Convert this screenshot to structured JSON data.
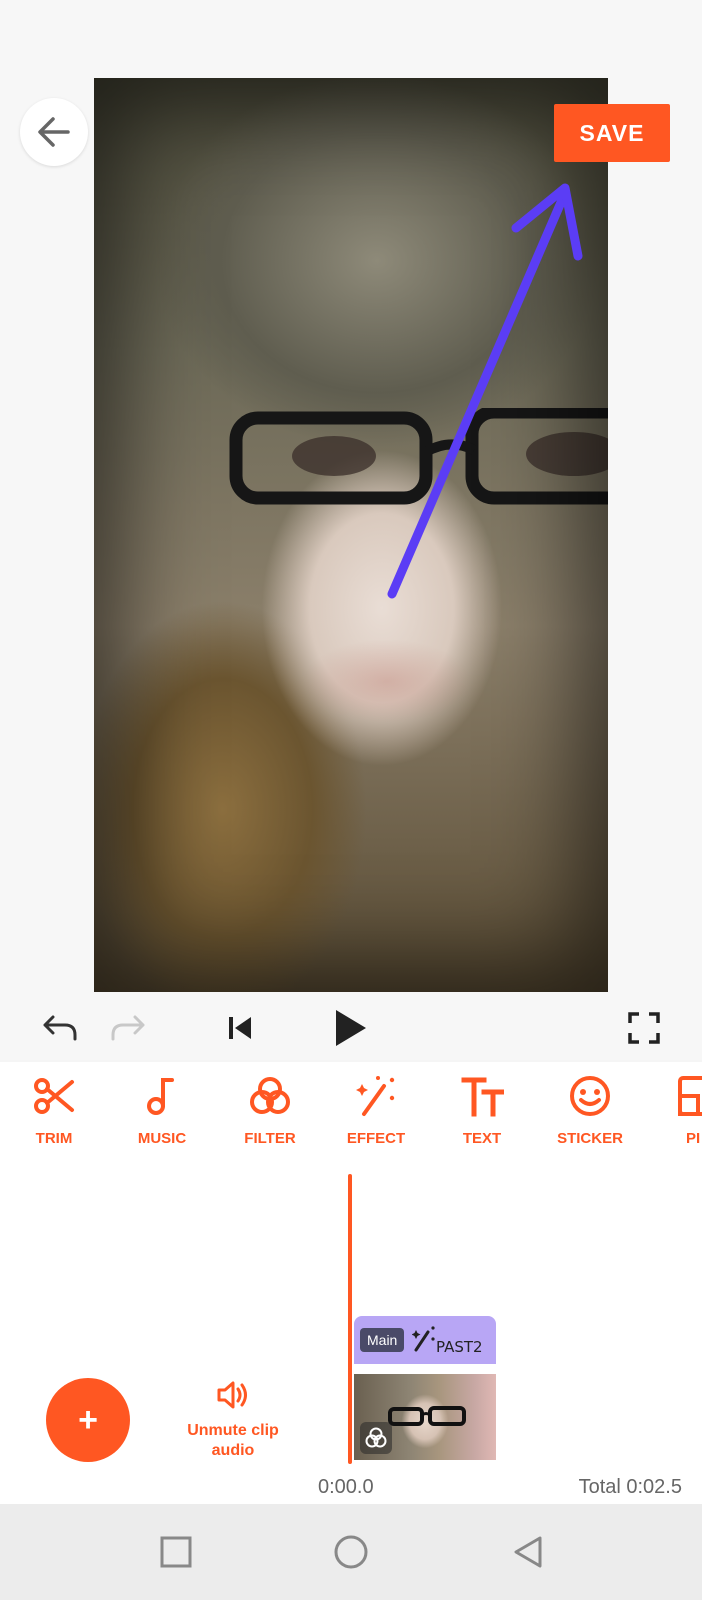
{
  "header": {
    "save_label": "SAVE"
  },
  "icons": {
    "back": "arrow-left-icon",
    "undo": "undo-icon",
    "redo": "redo-icon",
    "skip_start": "skip-to-start-icon",
    "play": "play-icon",
    "fullscreen": "fullscreen-icon"
  },
  "toolbar": {
    "items": [
      {
        "label": "TRIM",
        "icon": "scissors-icon"
      },
      {
        "label": "MUSIC",
        "icon": "music-note-icon"
      },
      {
        "label": "FILTER",
        "icon": "filter-circles-icon"
      },
      {
        "label": "EFFECT",
        "icon": "magic-wand-icon"
      },
      {
        "label": "TEXT",
        "icon": "text-icon"
      },
      {
        "label": "STICKER",
        "icon": "smiley-icon"
      },
      {
        "label": "PI",
        "icon": "pip-icon"
      }
    ]
  },
  "timeline": {
    "clip_badge": "Main",
    "effect_name": "PAST2",
    "unmute_label": "Unmute clip audio",
    "current_time": "0:00.0",
    "total_time": "Total 0:02.5",
    "add_label": "+"
  },
  "colors": {
    "accent": "#ff5722",
    "clip_header": "#b8a6f5",
    "annotation_arrow": "#5b3df5"
  }
}
